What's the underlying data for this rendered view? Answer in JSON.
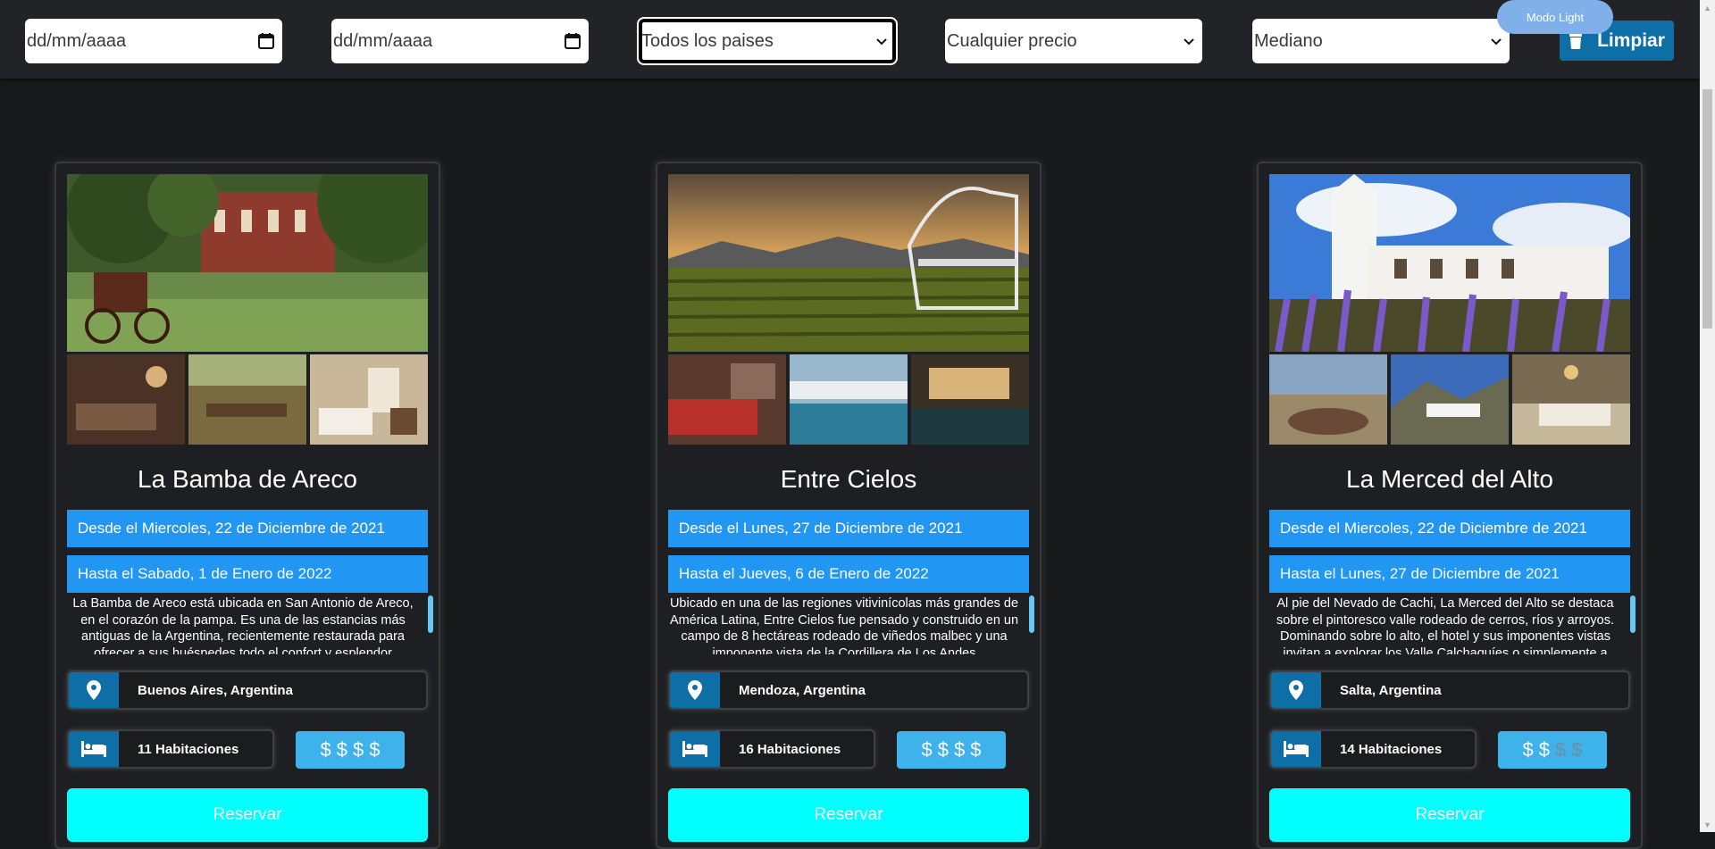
{
  "filters": {
    "date_from_value": "dd/mm/aaaa",
    "date_to_value": "dd/mm/aaaa",
    "country_value": "Todos los paises",
    "price_value": "Cualquier precio",
    "size_value": "Mediano",
    "clear_label": "Limpiar",
    "theme_label": "Modo Light"
  },
  "colors": {
    "accent_blue": "#2196f3",
    "icon_blue": "#0e6fa6",
    "reserve_cyan": "#00ffff",
    "price_blue": "#3eb2ea"
  },
  "cards": [
    {
      "title": "La Bamba de Areco",
      "date_from": "Desde el Miercoles, 22 de Diciembre de 2021",
      "date_to": "Hasta el Sabado, 1 de Enero de 2022",
      "description": "La Bamba de Areco está ubicada en San Antonio de Areco, en el corazón de la pampa. Es una de las estancias más antiguas de la Argentina, recientemente restaurada para ofrecer a sus huéspedes todo el confort y esplendor",
      "location": "Buenos Aires, Argentina",
      "rooms": "11 Habitaciones",
      "price_level": 4,
      "price_max": 4,
      "reserve_label": "Reservar"
    },
    {
      "title": "Entre Cielos",
      "date_from": "Desde el Lunes, 27 de Diciembre de 2021",
      "date_to": "Hasta el Jueves, 6 de Enero de 2022",
      "description": "Ubicado en una de las regiones vitivinícolas más grandes de América Latina, Entre Cielos fue pensado y construido en un campo de 8 hectáreas rodeado de viñedos malbec y una imponente vista de la Cordillera de Los Andes",
      "location": "Mendoza, Argentina",
      "rooms": "16 Habitaciones",
      "price_level": 4,
      "price_max": 4,
      "reserve_label": "Reservar"
    },
    {
      "title": "La Merced del Alto",
      "date_from": "Desde el Miercoles, 22 de Diciembre de 2021",
      "date_to": "Hasta el Lunes, 27 de Diciembre de 2021",
      "description": "Al pie del Nevado de Cachi, La Merced del Alto se destaca sobre el pintoresco valle rodeado de cerros, ríos y arroyos. Dominando sobre lo alto, el hotel y sus imponentes vistas invitan a explorar los Valle Calchaquíes o simplemente a",
      "location": "Salta, Argentina",
      "rooms": "14 Habitaciones",
      "price_level": 2,
      "price_max": 4,
      "reserve_label": "Reservar"
    }
  ]
}
